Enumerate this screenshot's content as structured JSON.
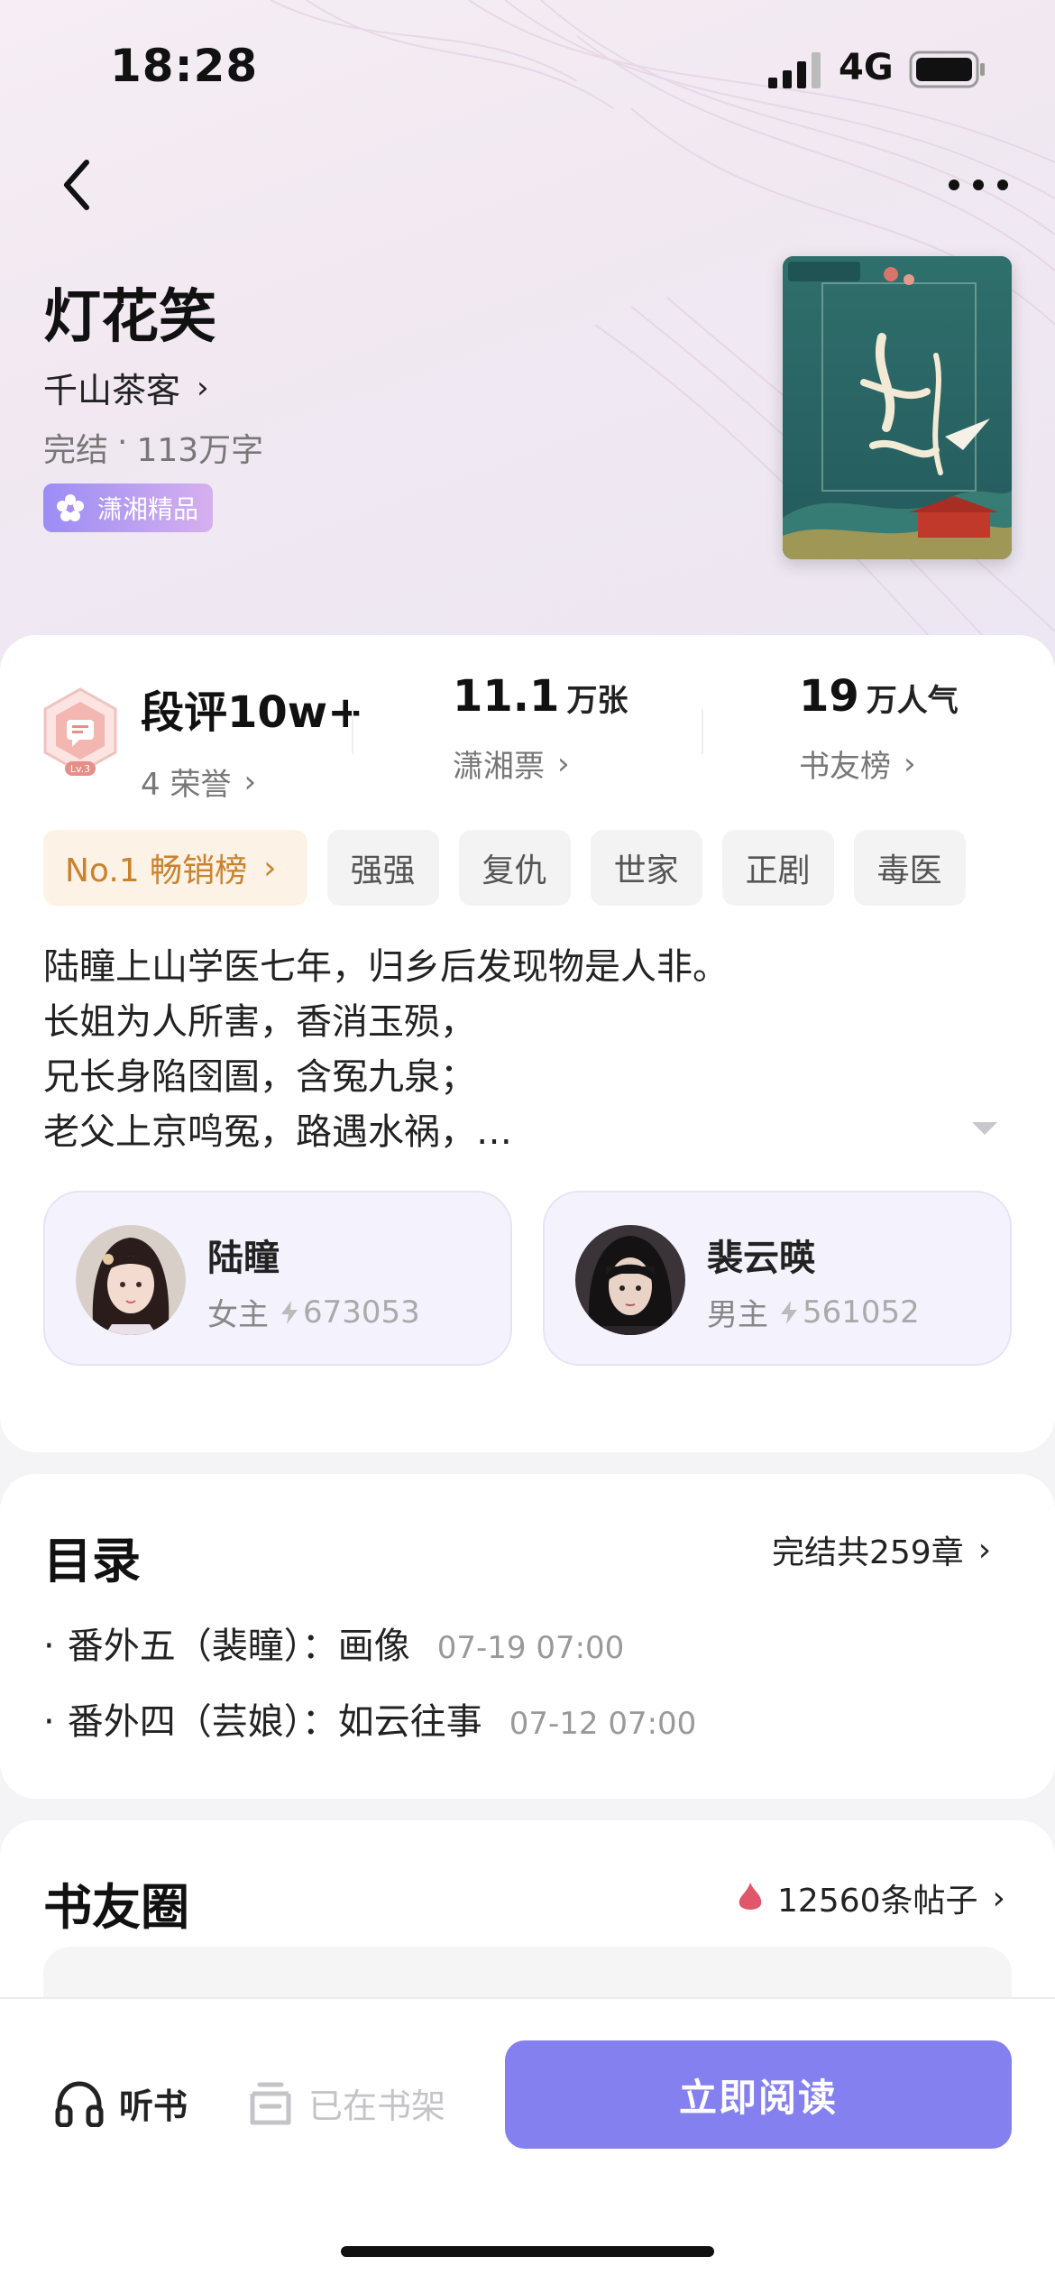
{
  "status": {
    "time": "18:28",
    "network": "4G"
  },
  "book": {
    "title": "灯花笑",
    "author": "千山茶客",
    "status": "完结",
    "word_count": "113万字",
    "tag": "潇湘精品"
  },
  "stats": {
    "review": {
      "value": "段评10w+",
      "sub": "4 荣誉"
    },
    "tickets": {
      "value": "11.1",
      "unit": "万张",
      "sub": "潇湘票"
    },
    "popularity": {
      "value": "19",
      "unit": "万人气",
      "sub": "书友榜"
    }
  },
  "rank_chip": {
    "label": "No.1 畅销榜"
  },
  "tags": [
    "强强",
    "复仇",
    "世家",
    "正剧",
    "毒医"
  ],
  "intro_lines": [
    "陆瞳上山学医七年，归乡后发现物是人非。",
    "长姐为人所害，香消玉殒，",
    "兄长身陷囹圄，含冤九泉；",
    "老父上京鸣冤，路遇水祸，…"
  ],
  "characters": [
    {
      "name": "陆瞳",
      "role": "女主",
      "score": "673053"
    },
    {
      "name": "裴云暎",
      "role": "男主",
      "score": "561052"
    }
  ],
  "toc": {
    "title": "目录",
    "summary": "完结共259章",
    "chapters": [
      {
        "title": "番外五（裴瞳）：画像",
        "time": "07-19 07:00"
      },
      {
        "title": "番外四（芸娘）：如云往事",
        "time": "07-12 07:00"
      }
    ]
  },
  "circle": {
    "title": "书友圈",
    "posts": "12560条帖子"
  },
  "bottom": {
    "listen": "听书",
    "shelf": "已在书架",
    "read": "立即阅读"
  },
  "colors": {
    "accent": "#8580f0",
    "rank": "#c9832e"
  }
}
